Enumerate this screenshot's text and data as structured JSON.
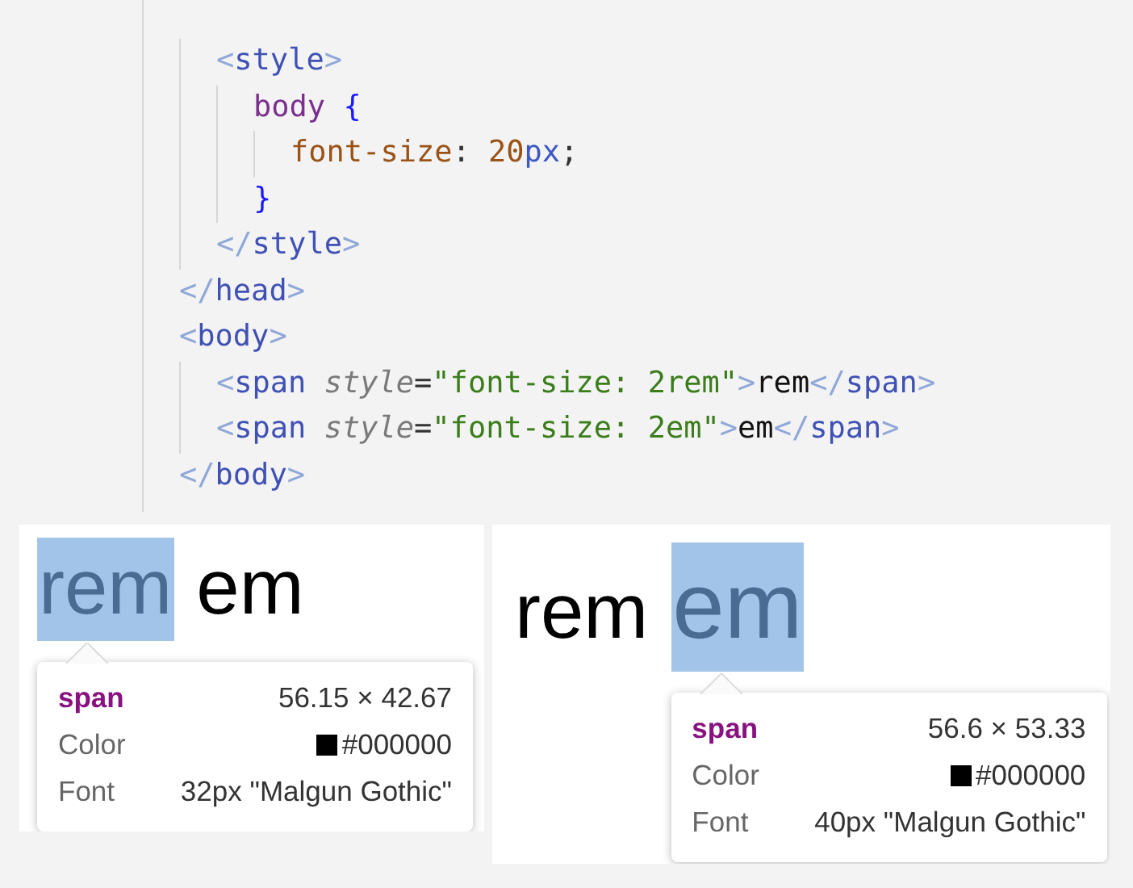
{
  "code": {
    "lines": [
      {
        "children": [
          {
            "tokens": [
              {
                "kind": "bracket",
                "text": "<"
              },
              {
                "kind": "tag",
                "text": "style"
              },
              {
                "kind": "bracket",
                "text": ">"
              }
            ],
            "children": [
              {
                "tokens": [
                  {
                    "kind": "selector",
                    "text": "body"
                  },
                  {
                    "kind": "brace",
                    "text": "{",
                    "spaced": true
                  }
                ],
                "children": [
                  {
                    "tokens": [
                      {
                        "kind": "prop",
                        "text": "font-size"
                      },
                      {
                        "kind": "plain",
                        "text": ":"
                      },
                      {
                        "kind": "number",
                        "text": "20",
                        "spaced": true
                      },
                      {
                        "kind": "unit",
                        "text": "px"
                      },
                      {
                        "kind": "plain",
                        "text": ";"
                      }
                    ]
                  }
                ]
              },
              {
                "tokens": [
                  {
                    "kind": "brace",
                    "text": "}"
                  }
                ]
              }
            ]
          },
          {
            "tokens": [
              {
                "kind": "bracket",
                "text": "</"
              },
              {
                "kind": "tag",
                "text": "style"
              },
              {
                "kind": "bracket",
                "text": ">"
              }
            ]
          }
        ]
      },
      {
        "tokens": [
          {
            "kind": "bracket",
            "text": "</"
          },
          {
            "kind": "tag",
            "text": "head"
          },
          {
            "kind": "bracket",
            "text": ">"
          }
        ]
      },
      {
        "tokens": [
          {
            "kind": "bracket",
            "text": "<"
          },
          {
            "kind": "tag",
            "text": "body"
          },
          {
            "kind": "bracket",
            "text": ">"
          }
        ],
        "children": [
          {
            "tokens": [
              {
                "kind": "bracket",
                "text": "<"
              },
              {
                "kind": "tag",
                "text": "span"
              },
              {
                "kind": "attr",
                "text": "style",
                "spaced": true
              },
              {
                "kind": "plain",
                "text": "="
              },
              {
                "kind": "string",
                "text": "\"font-size: 2rem\""
              },
              {
                "kind": "bracket",
                "text": ">"
              },
              {
                "kind": "text",
                "text": "rem"
              },
              {
                "kind": "bracket",
                "text": "</"
              },
              {
                "kind": "tag",
                "text": "span"
              },
              {
                "kind": "bracket",
                "text": ">"
              }
            ]
          },
          {
            "tokens": [
              {
                "kind": "bracket",
                "text": "<"
              },
              {
                "kind": "tag",
                "text": "span"
              },
              {
                "kind": "attr",
                "text": "style",
                "spaced": true
              },
              {
                "kind": "plain",
                "text": "="
              },
              {
                "kind": "string",
                "text": "\"font-size: 2em\""
              },
              {
                "kind": "bracket",
                "text": ">"
              },
              {
                "kind": "text",
                "text": "em"
              },
              {
                "kind": "bracket",
                "text": "</"
              },
              {
                "kind": "tag",
                "text": "span"
              },
              {
                "kind": "bracket",
                "text": ">"
              }
            ]
          }
        ]
      },
      {
        "tokens": [
          {
            "kind": "bracket",
            "text": "</"
          },
          {
            "kind": "tag",
            "text": "body"
          },
          {
            "kind": "bracket",
            "text": ">"
          }
        ]
      }
    ]
  },
  "previews": [
    {
      "spans": [
        {
          "text": "rem",
          "selected": true
        },
        {
          "text": "em",
          "selected": false
        }
      ],
      "tooltip": {
        "tag": "span",
        "size": "56.15 × 42.67",
        "rows": [
          {
            "kind": "color",
            "label": "Color",
            "value": "#000000"
          },
          {
            "kind": "text",
            "label": "Font",
            "value": "32px \"Malgun Gothic\""
          }
        ]
      }
    },
    {
      "spans": [
        {
          "text": "rem",
          "selected": false
        },
        {
          "text": "em",
          "selected": true
        }
      ],
      "tooltip": {
        "tag": "span",
        "size": "56.6 × 53.33",
        "rows": [
          {
            "kind": "color",
            "label": "Color",
            "value": "#000000"
          },
          {
            "kind": "text",
            "label": "Font",
            "value": "40px \"Malgun Gothic\""
          }
        ]
      }
    }
  ]
}
